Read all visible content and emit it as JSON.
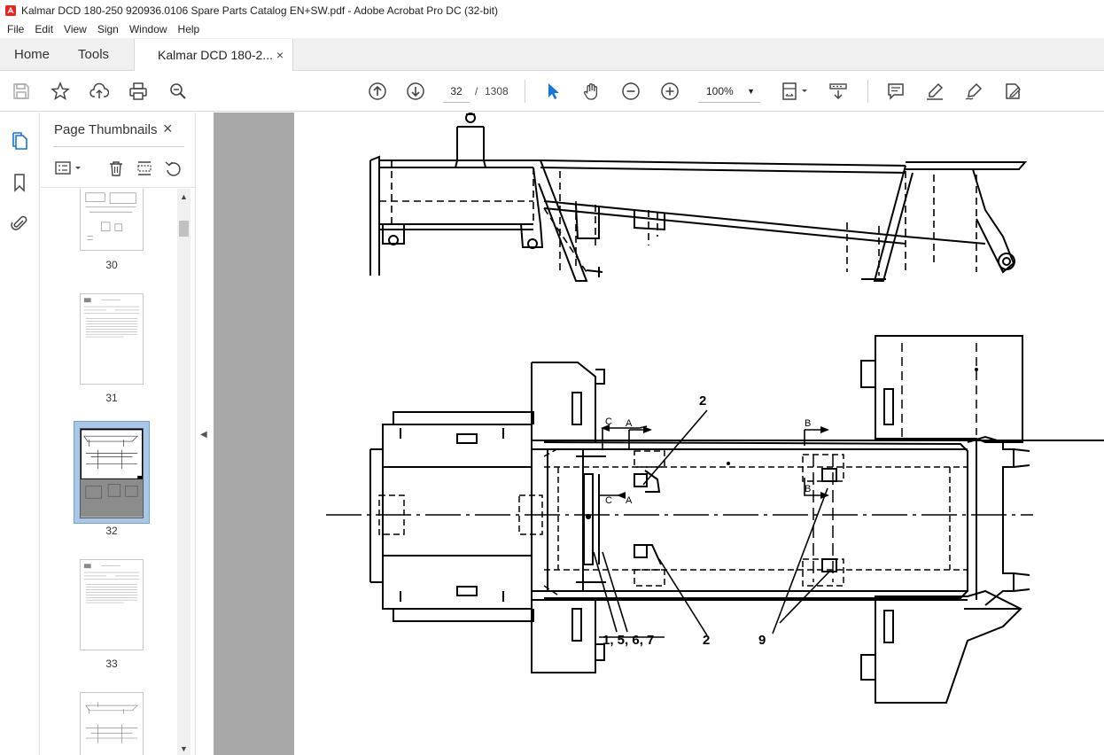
{
  "window": {
    "title": "Kalmar DCD 180-250 920936.0106 Spare Parts Catalog EN+SW.pdf - Adobe Acrobat Pro DC (32-bit)"
  },
  "menu": [
    "File",
    "Edit",
    "View",
    "Sign",
    "Window",
    "Help"
  ],
  "tabs": {
    "home": "Home",
    "tools": "Tools",
    "document": "Kalmar DCD 180-2...",
    "close": "×"
  },
  "toolbar": {
    "current_page": "32",
    "page_separator": "/",
    "total_pages": "1308",
    "zoom": "100%"
  },
  "panel": {
    "title": "Page Thumbnails",
    "close": "×",
    "thumbnails": [
      {
        "label": "30"
      },
      {
        "label": "31"
      },
      {
        "label": "32",
        "selected": true
      },
      {
        "label": "33"
      },
      {
        "label": ""
      }
    ]
  },
  "drawing": {
    "callouts": {
      "top_2": "2",
      "bottom_2": "2",
      "parts": "1, 5, 6, 7",
      "nine": "9",
      "c_top": "C",
      "a_top": "A",
      "c_bot": "C",
      "a_bot": "A",
      "b_top": "B",
      "b_bot": "B"
    }
  },
  "colors": {
    "accent": "#1473e6",
    "canvas_bg": "#a8a8a8",
    "selected_thumb": "#a9c7e8"
  }
}
